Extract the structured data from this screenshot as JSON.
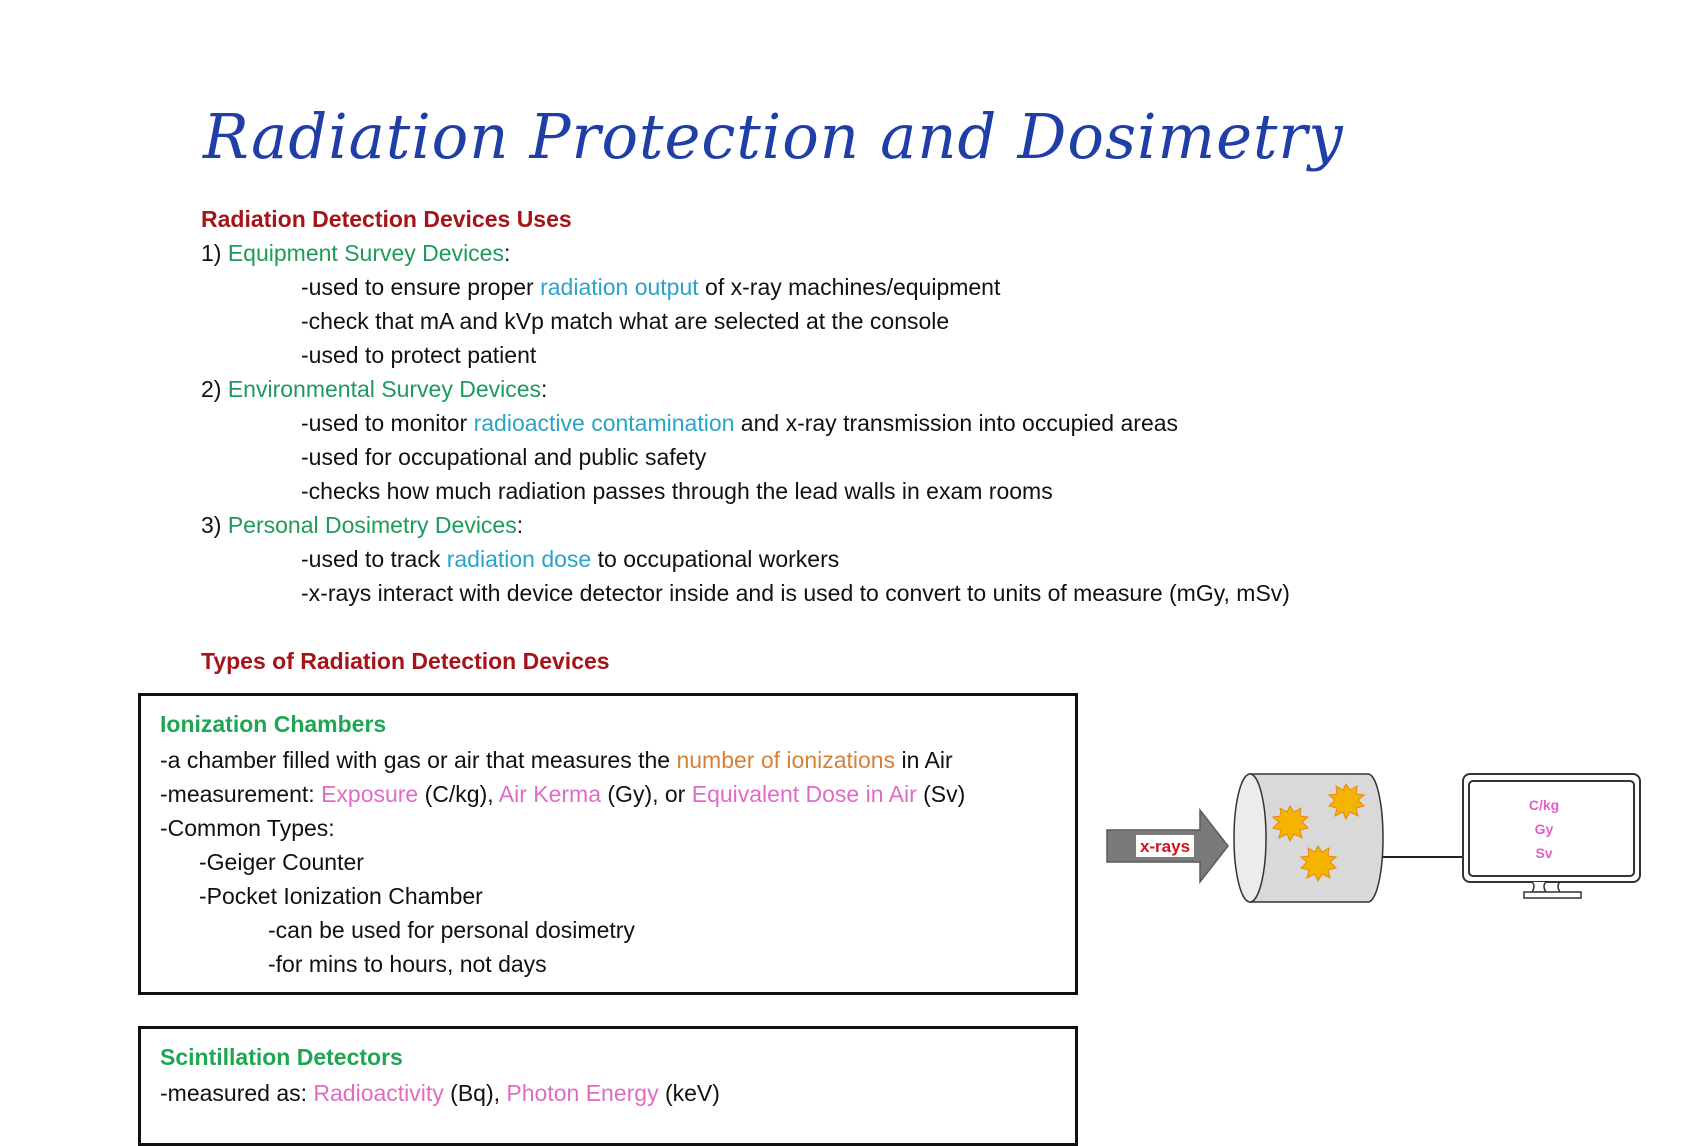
{
  "document": {
    "title": "Radiation Protection and Dosimetry",
    "section_uses": {
      "heading": "Radiation Detection Devices Uses",
      "items": [
        {
          "number": "1)",
          "name": "Equipment Survey Devices",
          "colon": ":",
          "points": [
            {
              "pre": "-used to ensure proper ",
              "hl": "radiation output",
              "post": " of x-ray machines/equipment"
            },
            {
              "pre": "-check that mA and kVp match what are selected at the console",
              "hl": "",
              "post": ""
            },
            {
              "pre": "-used to protect patient",
              "hl": "",
              "post": ""
            }
          ]
        },
        {
          "number": "2)",
          "name": "Environmental Survey Devices",
          "colon": ":",
          "points": [
            {
              "pre": "-used to monitor ",
              "hl": "radioactive contamination",
              "post": " and x-ray transmission into occupied areas"
            },
            {
              "pre": "-used for occupational and public safety",
              "hl": "",
              "post": ""
            },
            {
              "pre": "-checks how much radiation passes through the lead walls in exam rooms",
              "hl": "",
              "post": ""
            }
          ]
        },
        {
          "number": "3)",
          "name": "Personal Dosimetry Devices",
          "colon": ":",
          "points": [
            {
              "pre": "-used to track ",
              "hl": "radiation dose",
              "post": " to occupational workers"
            },
            {
              "pre": "-x-rays interact with device detector inside and is used to convert to units of measure (mGy, mSv)",
              "hl": "",
              "post": ""
            }
          ]
        }
      ]
    },
    "section_types": {
      "heading": "Types of Radiation Detection Devices",
      "ionization_box": {
        "title": "Ionization Chambers",
        "line1": {
          "pre": "-a chamber filled with gas or air that measures the ",
          "hl": "number of ionizations",
          "post": " in Air"
        },
        "line2": {
          "pre": "-measurement: ",
          "hl1": "Exposure",
          "mid1": " (C/kg), ",
          "hl2": "Air Kerma",
          "mid2": " (Gy), or ",
          "hl3": "Equivalent Dose in Air",
          "post": " (Sv)"
        },
        "line3": "-Common Types:",
        "line4": "-Geiger Counter",
        "line5": "-Pocket Ionization Chamber",
        "line6": "-can be used for personal dosimetry",
        "line7": "-for mins to hours, not days"
      },
      "scintillation_box": {
        "title": "Scintillation Detectors",
        "line1": {
          "pre": "-measured as: ",
          "hl1": "Radioactivity",
          "mid1": " (Bq), ",
          "hl2": "Photon Energy",
          "post": " (keV)"
        }
      }
    },
    "diagram": {
      "arrow_label": "x-rays",
      "monitor_units": [
        "C/kg",
        "Gy",
        "Sv"
      ],
      "colors": {
        "arrow": "#7a7a7a",
        "arrow_label": "#d0121b",
        "cylinder": "#d9d9d9",
        "cylinder_face": "#ececec",
        "burst": "#f5b400",
        "unit_text": "#e060c8"
      }
    }
  }
}
